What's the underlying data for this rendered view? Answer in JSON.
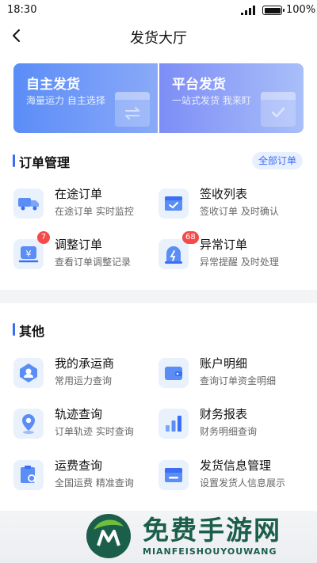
{
  "status": {
    "time": "18:30",
    "battery": "100%"
  },
  "nav": {
    "title": "发货大厅"
  },
  "banners": [
    {
      "title": "自主发货",
      "subtitle": "海量运力 自主选择"
    },
    {
      "title": "平台发货",
      "subtitle": "一站式发货 我来盯"
    }
  ],
  "orders": {
    "title": "订单管理",
    "all_label": "全部订单",
    "items": [
      {
        "title": "在途订单",
        "subtitle": "在途订单 实时监控",
        "icon": "truck-icon"
      },
      {
        "title": "签收列表",
        "subtitle": "签收订单 及时确认",
        "icon": "sign-box-icon"
      },
      {
        "title": "调整订单",
        "subtitle": "查看订单调整记录",
        "icon": "yuan-adjust-icon",
        "badge": "7"
      },
      {
        "title": "异常订单",
        "subtitle": "异常提醒 及时处理",
        "icon": "alert-icon",
        "badge": "68"
      }
    ]
  },
  "other": {
    "title": "其他",
    "items": [
      {
        "title": "我的承运商",
        "subtitle": "常用运力查询",
        "icon": "carrier-icon"
      },
      {
        "title": "账户明细",
        "subtitle": "查询订单资金明细",
        "icon": "wallet-icon"
      },
      {
        "title": "轨迹查询",
        "subtitle": "订单轨迹 实时查询",
        "icon": "location-icon"
      },
      {
        "title": "财务报表",
        "subtitle": "财务明细查询",
        "icon": "bar-chart-icon"
      },
      {
        "title": "运费查询",
        "subtitle": "全国运费 精准查询",
        "icon": "freight-search-icon"
      },
      {
        "title": "发货信息管理",
        "subtitle": "设置发货人信息展示",
        "icon": "shipper-info-icon"
      }
    ]
  },
  "watermark": {
    "title": "免费手游网",
    "subtitle": "MIANFEISHOUYOUWANG"
  },
  "colors": {
    "accent": "#3b6ef5",
    "badge": "#f44a4a",
    "icon_bg": "#e9f1fd"
  }
}
